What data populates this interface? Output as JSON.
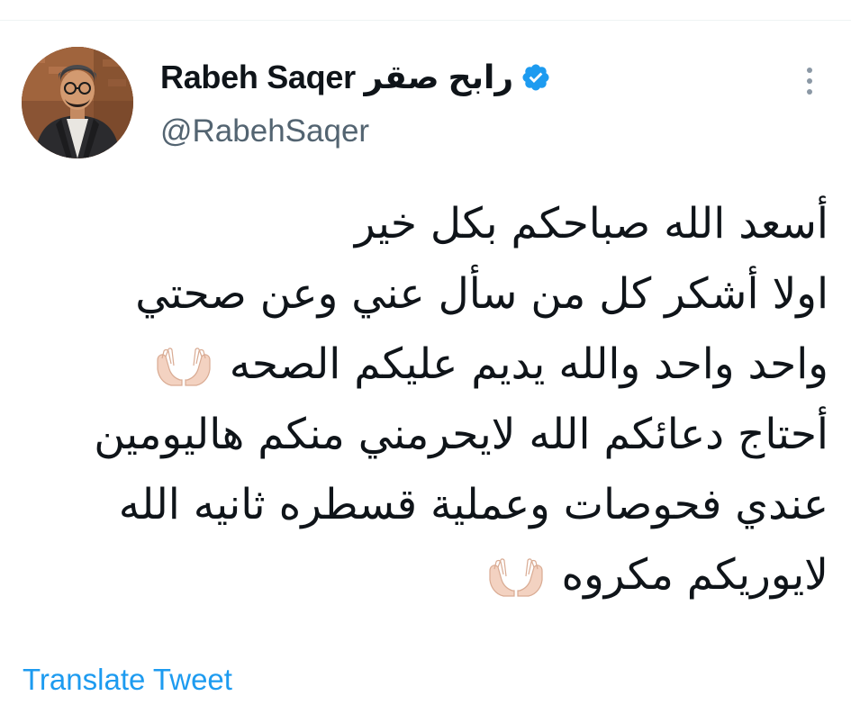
{
  "tweet": {
    "author": {
      "display_name": "Rabeh Saqer رابح صقر",
      "handle": "@RabehSaqer",
      "verified": true
    },
    "lines": [
      {
        "text": "أسعد الله صباحكم بكل خير",
        "emoji": false
      },
      {
        "text": "اولا أشكر كل من سأل عني وعن صحتي",
        "emoji": false
      },
      {
        "text": "واحد واحد والله يديم عليكم الصحه",
        "emoji": true
      },
      {
        "text": "أحتاج دعائكم الله لايحرمني منكم هاليومين",
        "emoji": false
      },
      {
        "text": "عندي فحوصات وعملية قسطره ثانيه الله",
        "emoji": false
      },
      {
        "text": "لايوريكم مكروه",
        "emoji": true
      }
    ],
    "translate_label": "Translate Tweet"
  },
  "icons": {
    "verified": "verified-badge-icon",
    "more": "more-vertical-icon",
    "emoji": "palms-up-together-emoji"
  },
  "colors": {
    "verified_blue": "#1d9bf0",
    "link_blue": "#1d9bf0",
    "handle_gray": "#536471",
    "text": "#0f1419"
  }
}
